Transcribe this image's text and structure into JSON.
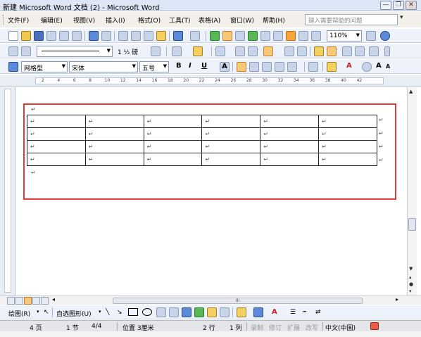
{
  "window": {
    "title": "新建 Microsoft Word 文档 (2) - Microsoft Word",
    "minimize": "—",
    "restore": "❐",
    "close": "✕"
  },
  "menubar": {
    "items": [
      "文件(F)",
      "编辑(E)",
      "视图(V)",
      "插入(I)",
      "格式(O)",
      "工具(T)",
      "表格(A)",
      "窗口(W)",
      "帮助(H)"
    ],
    "help_placeholder": "键入需要帮助的问题"
  },
  "toolbar_standard": {
    "zoom": "110%"
  },
  "toolbar_tables": {
    "line_weight": "1 ½ 磅",
    "pen_label": "✎"
  },
  "toolbar_formatting": {
    "style_value": "网格型",
    "font_value": "宋体",
    "size_value": "五号",
    "bold": "B",
    "italic": "I",
    "underline": "U",
    "font_color_glyph": "A",
    "grow": "A",
    "shrink": "A"
  },
  "ruler": {
    "ticks": [
      "2",
      "4",
      "6",
      "8",
      "10",
      "12",
      "14",
      "16",
      "18",
      "20",
      "22",
      "24",
      "26",
      "28",
      "30",
      "32",
      "34",
      "36",
      "38",
      "40",
      "42"
    ]
  },
  "document": {
    "paragraph_mark": "↵",
    "table": {
      "rows": 4,
      "cols": 6,
      "cells": [
        [
          "↵",
          "↵",
          "↵",
          "↵",
          "↵",
          "↵"
        ],
        [
          "↵",
          "↵",
          "↵",
          "↵",
          "↵",
          "↵"
        ],
        [
          "↵",
          "↵",
          "↵",
          "↵",
          "↵",
          "↵"
        ],
        [
          "↵",
          "↵",
          "↵",
          "↵",
          "↵",
          "↵"
        ]
      ]
    },
    "highlight_color": "#e23a3a"
  },
  "hscroll": {
    "thumb_glyph": "III"
  },
  "drawing_toolbar": {
    "draw_label": "绘图(R)",
    "autoshapes_label": "自选图形(U)"
  },
  "statusbar": {
    "page": "4 页",
    "section": "1 节",
    "page_of": "4/4",
    "position": "位置 3厘米",
    "line": "2 行",
    "column": "1 列",
    "rec": "录制",
    "trk": "修订",
    "ext": "扩展",
    "ovr": "改写",
    "language": "中文(中国)"
  }
}
